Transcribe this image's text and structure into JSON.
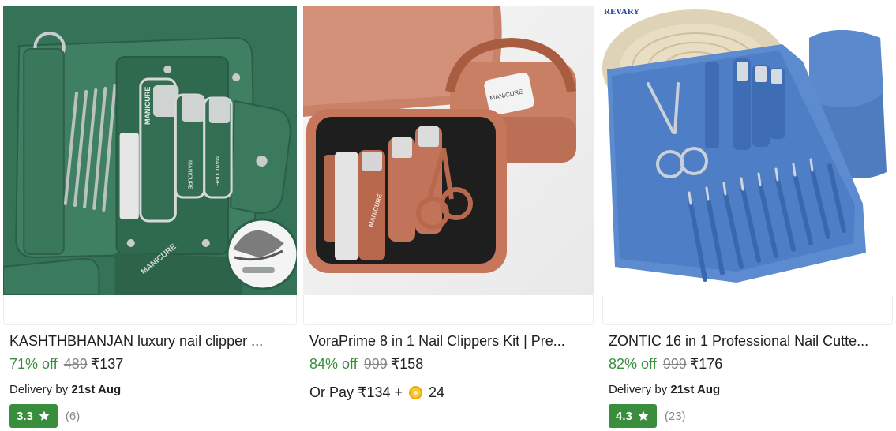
{
  "products": [
    {
      "title": "KASHTHBHANJAN luxury nail clipper ...",
      "discount": "71% off",
      "mrp": "489",
      "price": "₹137",
      "delivery_label": "Delivery by",
      "delivery_date": "21st Aug",
      "rating": "3.3",
      "rating_count": "(6)",
      "image_text": "MANICURE"
    },
    {
      "title": "VoraPrime 8 in 1 Nail Clippers Kit | Pre...",
      "discount": "84% off",
      "mrp": "999",
      "price": "₹158",
      "or_pay_label": "Or Pay ₹134 +",
      "coins": "24",
      "image_text": "MANICURE"
    },
    {
      "title": "ZONTIC 16 in 1 Professional Nail Cutte...",
      "discount": "82% off",
      "mrp": "999",
      "price": "₹176",
      "delivery_label": "Delivery by",
      "delivery_date": "21st Aug",
      "rating": "4.3",
      "rating_count": "(23)",
      "image_brand": "REVARY"
    }
  ],
  "colors": {
    "discount_green": "#388e3c",
    "rating_green": "#388e3c",
    "strike_grey": "#878787",
    "text": "#212121",
    "coin_yellow": "#f7c630"
  },
  "icons": {
    "rating": "star-icon",
    "coin": "supercoin-icon"
  }
}
